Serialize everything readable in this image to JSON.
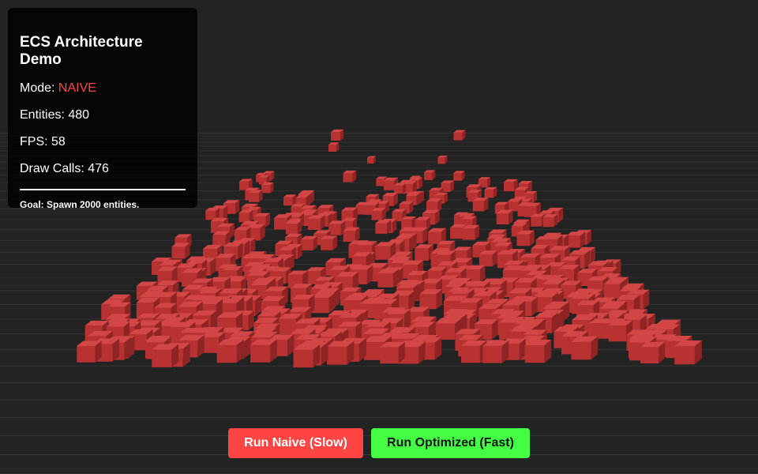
{
  "hud": {
    "title": "ECS Architecture Demo",
    "mode_label": "Mode: ",
    "mode_value": "NAIVE",
    "entities_label": "Entities: ",
    "entities_value": "480",
    "fps_label": "FPS: ",
    "fps_value": "58",
    "draw_calls_label": "Draw Calls: ",
    "draw_calls_value": "476",
    "goal": "Goal: Spawn 2000 entities."
  },
  "controls": {
    "naive_button": "Run Naive (Slow)",
    "optimized_button": "Run Optimized (Fast)"
  },
  "colors": {
    "background": "#232323",
    "grid_line": "#3a3a3a",
    "cube_top": "#d24646",
    "cube_front": "#b83232",
    "cube_side": "#8e2424",
    "mode_naive": "#ff4444",
    "button_naive": "#ff4444",
    "button_optimized": "#44ff44"
  },
  "scene": {
    "entity_shape": "cube",
    "entity_count_shown": 480
  }
}
